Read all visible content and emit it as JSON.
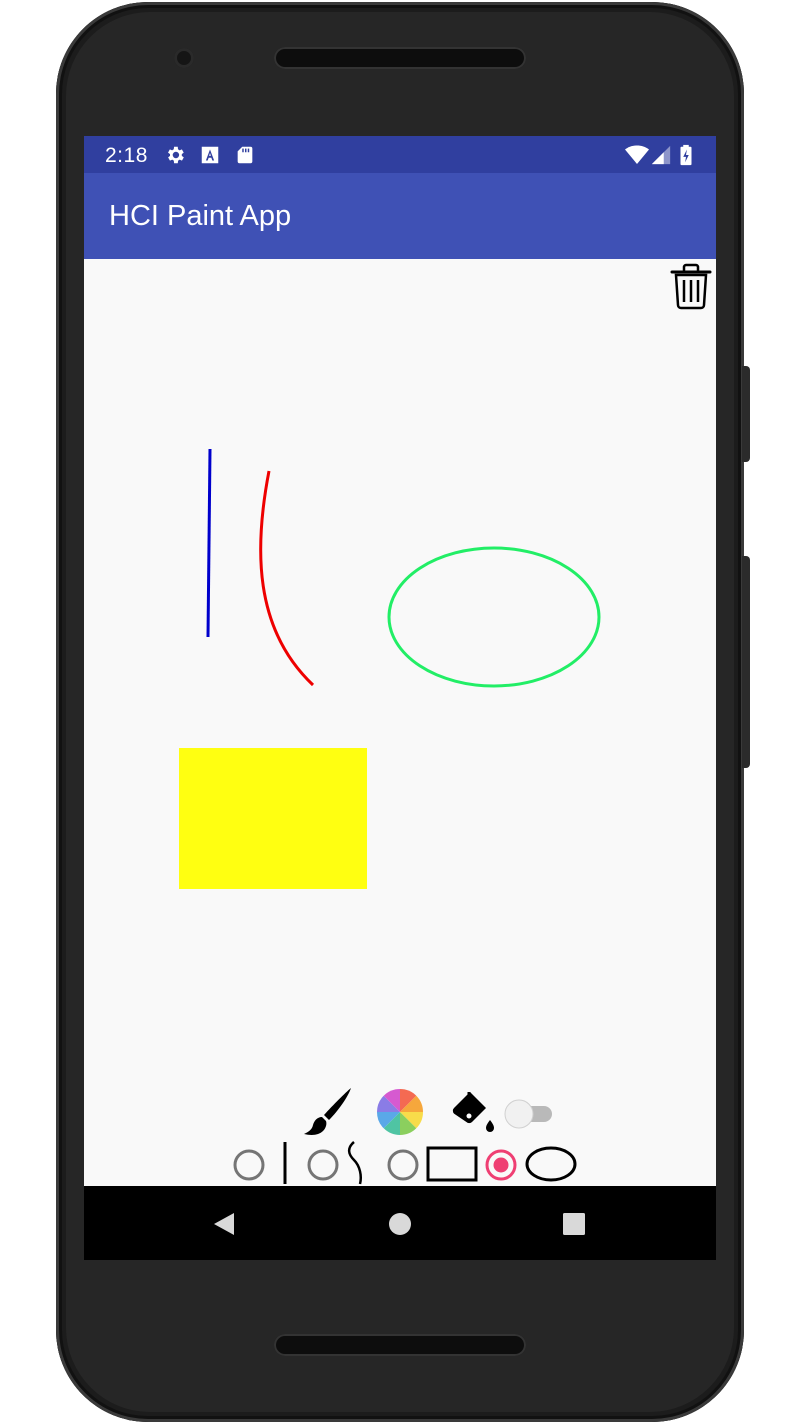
{
  "status_bar": {
    "time": "2:18",
    "icons_left": [
      "settings-icon",
      "text-a-icon",
      "sd-card-icon"
    ],
    "icons_right": [
      "wifi-icon",
      "cell-signal-icon",
      "battery-charging-icon"
    ]
  },
  "app_bar": {
    "title": "HCI Paint App"
  },
  "canvas": {
    "background": "#f9f9f9",
    "drawings": [
      {
        "kind": "line",
        "color": "#0000cc"
      },
      {
        "kind": "curve",
        "color": "#ee0000"
      },
      {
        "kind": "ellipse",
        "color": "#22ee66"
      },
      {
        "kind": "filled-rectangle",
        "color": "#ffff11"
      }
    ],
    "trash_icon": "trash-icon"
  },
  "toolbar": {
    "tools": [
      "brush-icon",
      "color-wheel-icon",
      "paint-bucket-icon"
    ],
    "fill_toggle": {
      "on": false
    },
    "shape_options": [
      "line",
      "freehand",
      "rectangle",
      "ellipse"
    ],
    "selected_shape": "ellipse",
    "accent_color": "#ef3f73"
  },
  "nav_bar": {
    "buttons": [
      "back-icon",
      "home-icon",
      "recents-icon"
    ]
  },
  "colors": {
    "status_bar": "#303f9f",
    "app_bar": "#3f51b5",
    "nav_bar": "#000000"
  }
}
